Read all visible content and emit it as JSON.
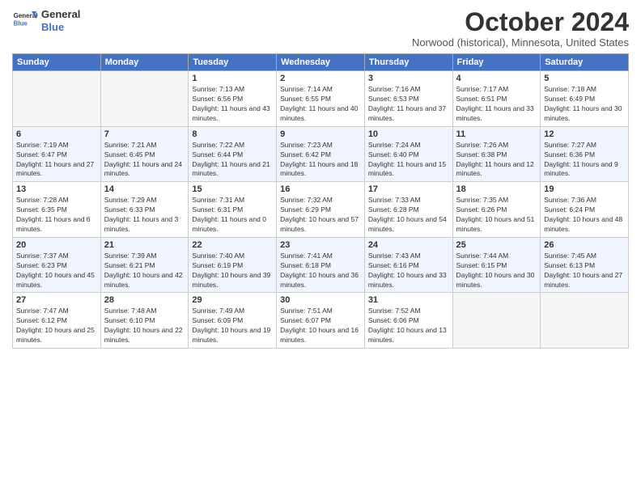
{
  "header": {
    "logo_line1": "General",
    "logo_line2": "Blue",
    "month_title": "October 2024",
    "subtitle": "Norwood (historical), Minnesota, United States"
  },
  "days_of_week": [
    "Sunday",
    "Monday",
    "Tuesday",
    "Wednesday",
    "Thursday",
    "Friday",
    "Saturday"
  ],
  "weeks": [
    [
      {
        "num": "",
        "detail": ""
      },
      {
        "num": "",
        "detail": ""
      },
      {
        "num": "1",
        "detail": "Sunrise: 7:13 AM\nSunset: 6:56 PM\nDaylight: 11 hours and 43 minutes."
      },
      {
        "num": "2",
        "detail": "Sunrise: 7:14 AM\nSunset: 6:55 PM\nDaylight: 11 hours and 40 minutes."
      },
      {
        "num": "3",
        "detail": "Sunrise: 7:16 AM\nSunset: 6:53 PM\nDaylight: 11 hours and 37 minutes."
      },
      {
        "num": "4",
        "detail": "Sunrise: 7:17 AM\nSunset: 6:51 PM\nDaylight: 11 hours and 33 minutes."
      },
      {
        "num": "5",
        "detail": "Sunrise: 7:18 AM\nSunset: 6:49 PM\nDaylight: 11 hours and 30 minutes."
      }
    ],
    [
      {
        "num": "6",
        "detail": "Sunrise: 7:19 AM\nSunset: 6:47 PM\nDaylight: 11 hours and 27 minutes."
      },
      {
        "num": "7",
        "detail": "Sunrise: 7:21 AM\nSunset: 6:45 PM\nDaylight: 11 hours and 24 minutes."
      },
      {
        "num": "8",
        "detail": "Sunrise: 7:22 AM\nSunset: 6:44 PM\nDaylight: 11 hours and 21 minutes."
      },
      {
        "num": "9",
        "detail": "Sunrise: 7:23 AM\nSunset: 6:42 PM\nDaylight: 11 hours and 18 minutes."
      },
      {
        "num": "10",
        "detail": "Sunrise: 7:24 AM\nSunset: 6:40 PM\nDaylight: 11 hours and 15 minutes."
      },
      {
        "num": "11",
        "detail": "Sunrise: 7:26 AM\nSunset: 6:38 PM\nDaylight: 11 hours and 12 minutes."
      },
      {
        "num": "12",
        "detail": "Sunrise: 7:27 AM\nSunset: 6:36 PM\nDaylight: 11 hours and 9 minutes."
      }
    ],
    [
      {
        "num": "13",
        "detail": "Sunrise: 7:28 AM\nSunset: 6:35 PM\nDaylight: 11 hours and 6 minutes."
      },
      {
        "num": "14",
        "detail": "Sunrise: 7:29 AM\nSunset: 6:33 PM\nDaylight: 11 hours and 3 minutes."
      },
      {
        "num": "15",
        "detail": "Sunrise: 7:31 AM\nSunset: 6:31 PM\nDaylight: 11 hours and 0 minutes."
      },
      {
        "num": "16",
        "detail": "Sunrise: 7:32 AM\nSunset: 6:29 PM\nDaylight: 10 hours and 57 minutes."
      },
      {
        "num": "17",
        "detail": "Sunrise: 7:33 AM\nSunset: 6:28 PM\nDaylight: 10 hours and 54 minutes."
      },
      {
        "num": "18",
        "detail": "Sunrise: 7:35 AM\nSunset: 6:26 PM\nDaylight: 10 hours and 51 minutes."
      },
      {
        "num": "19",
        "detail": "Sunrise: 7:36 AM\nSunset: 6:24 PM\nDaylight: 10 hours and 48 minutes."
      }
    ],
    [
      {
        "num": "20",
        "detail": "Sunrise: 7:37 AM\nSunset: 6:23 PM\nDaylight: 10 hours and 45 minutes."
      },
      {
        "num": "21",
        "detail": "Sunrise: 7:39 AM\nSunset: 6:21 PM\nDaylight: 10 hours and 42 minutes."
      },
      {
        "num": "22",
        "detail": "Sunrise: 7:40 AM\nSunset: 6:19 PM\nDaylight: 10 hours and 39 minutes."
      },
      {
        "num": "23",
        "detail": "Sunrise: 7:41 AM\nSunset: 6:18 PM\nDaylight: 10 hours and 36 minutes."
      },
      {
        "num": "24",
        "detail": "Sunrise: 7:43 AM\nSunset: 6:16 PM\nDaylight: 10 hours and 33 minutes."
      },
      {
        "num": "25",
        "detail": "Sunrise: 7:44 AM\nSunset: 6:15 PM\nDaylight: 10 hours and 30 minutes."
      },
      {
        "num": "26",
        "detail": "Sunrise: 7:45 AM\nSunset: 6:13 PM\nDaylight: 10 hours and 27 minutes."
      }
    ],
    [
      {
        "num": "27",
        "detail": "Sunrise: 7:47 AM\nSunset: 6:12 PM\nDaylight: 10 hours and 25 minutes."
      },
      {
        "num": "28",
        "detail": "Sunrise: 7:48 AM\nSunset: 6:10 PM\nDaylight: 10 hours and 22 minutes."
      },
      {
        "num": "29",
        "detail": "Sunrise: 7:49 AM\nSunset: 6:09 PM\nDaylight: 10 hours and 19 minutes."
      },
      {
        "num": "30",
        "detail": "Sunrise: 7:51 AM\nSunset: 6:07 PM\nDaylight: 10 hours and 16 minutes."
      },
      {
        "num": "31",
        "detail": "Sunrise: 7:52 AM\nSunset: 6:06 PM\nDaylight: 10 hours and 13 minutes."
      },
      {
        "num": "",
        "detail": ""
      },
      {
        "num": "",
        "detail": ""
      }
    ]
  ]
}
